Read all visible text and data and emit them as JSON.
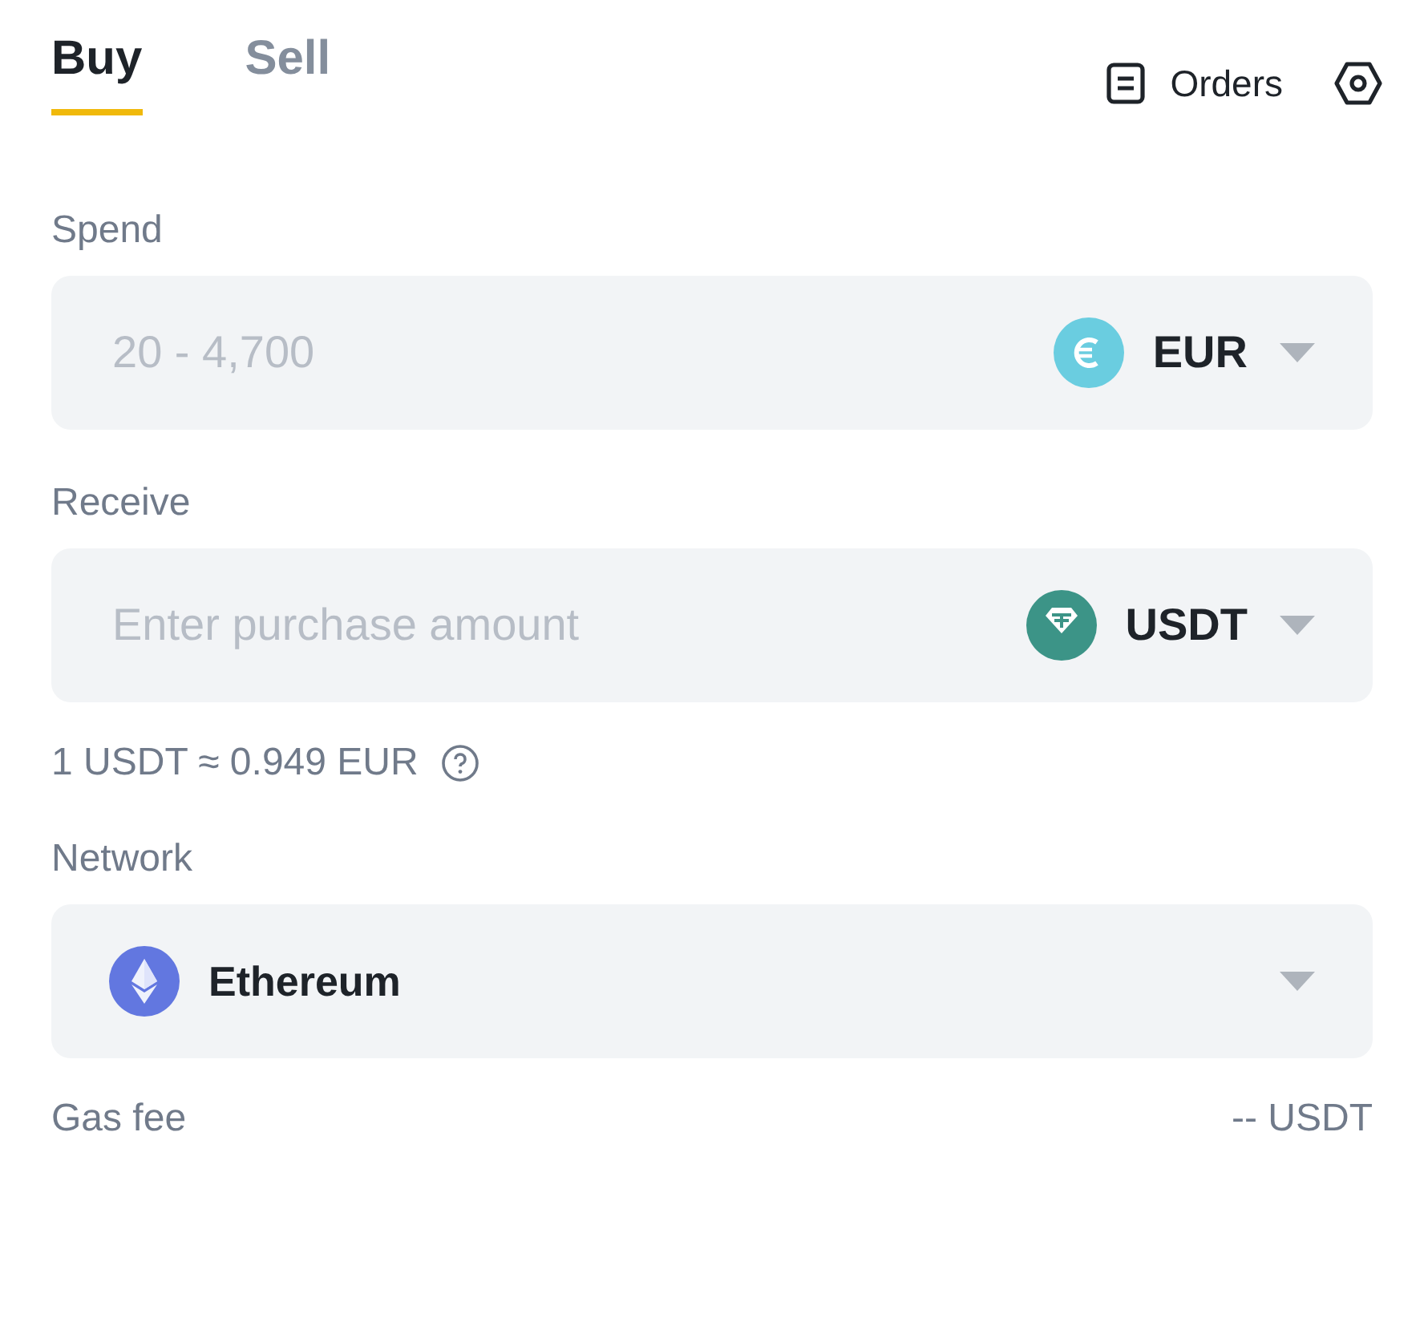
{
  "tabs": [
    {
      "label": "Buy",
      "selected": true
    },
    {
      "label": "Sell",
      "selected": false
    }
  ],
  "header_actions": {
    "orders": "Orders"
  },
  "fields": [
    {
      "kind": "amount",
      "label": "Spend",
      "placeholder": "20 - 4,700",
      "currency": "EUR",
      "coin": {
        "kind": "eur"
      }
    },
    {
      "kind": "amount",
      "label": "Receive",
      "placeholder": "Enter purchase amount",
      "currency": "USDT",
      "coin": {
        "kind": "usdt"
      },
      "note": "1 USDT ≈ 0.949 EUR"
    },
    {
      "kind": "select",
      "label": "Network",
      "value": "Ethereum",
      "coin": {
        "kind": "eth"
      }
    }
  ],
  "fee": {
    "label": "Gas fee",
    "value": "-- USDT"
  }
}
